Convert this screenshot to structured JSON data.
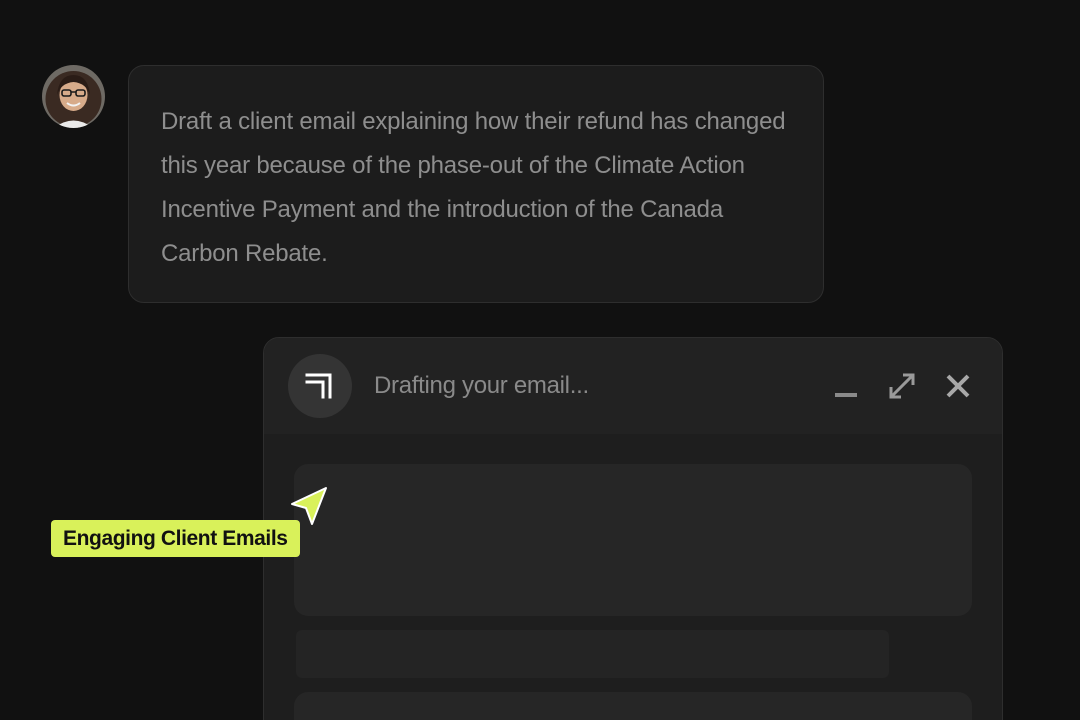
{
  "user_prompt": {
    "avatar_icon": "user-avatar-photo",
    "message": "Draft a client email explaining how their refund has changed this year because of the phase-out of the Climate Action Incentive Payment and the introduction of the Canada Carbon Rebate."
  },
  "draft_panel": {
    "logo_icon": "corner-arrow-logo-icon",
    "status_text": "Drafting your email...",
    "controls": [
      {
        "name": "minimize",
        "icon": "minimize-icon"
      },
      {
        "name": "expand",
        "icon": "expand-icon"
      },
      {
        "name": "close",
        "icon": "close-icon"
      }
    ],
    "loading": true
  },
  "collaborator_cursor": {
    "icon": "pointer-arrow-icon",
    "label": "Engaging Client Emails",
    "color": "#d9f15a"
  },
  "colors": {
    "background": "#111111",
    "accent": "#d9f15a"
  }
}
